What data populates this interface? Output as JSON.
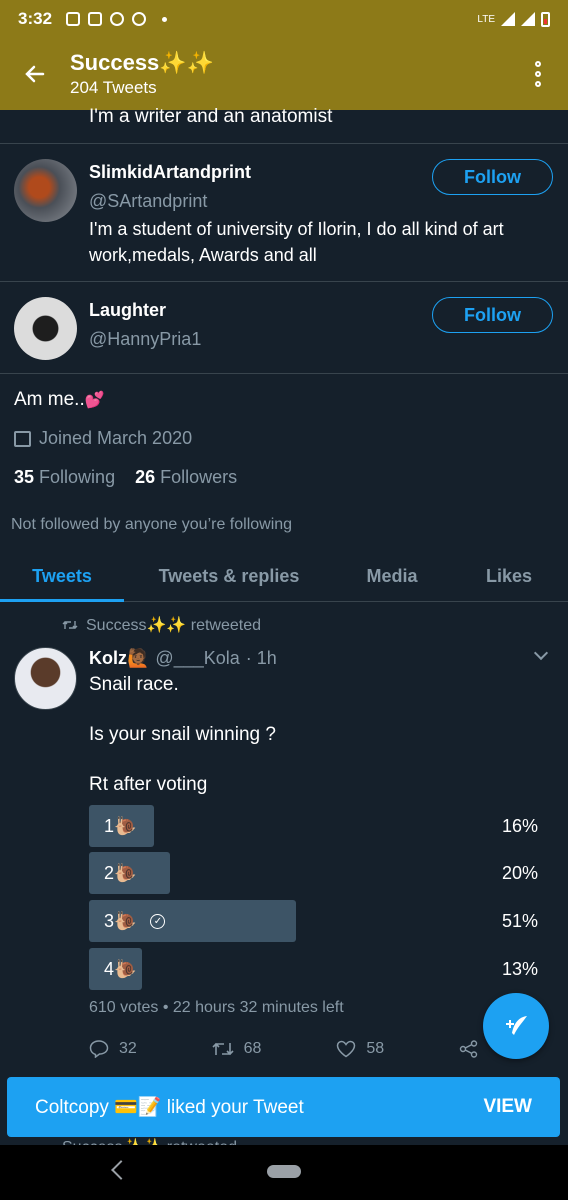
{
  "status_bar": {
    "time": "3:32",
    "network": "LTE",
    "icons": [
      "image-icon",
      "news-icon",
      "facebook-icon",
      "uc-browser-icon",
      "signal-icon",
      "battery-icon"
    ]
  },
  "header": {
    "title": "Success✨✨",
    "subtitle": "204 Tweets",
    "color": "#8d7a18"
  },
  "suggestions": {
    "partial_bio": "I'm a writer and an anatomist",
    "users": [
      {
        "name": "SlimkidArtandprint",
        "handle": "@SArtandprint",
        "bio": "I'm a student of university of Ilorin, I do all kind of art work,medals, Awards and all",
        "button": "Follow"
      },
      {
        "name": "Laughter",
        "handle": "@HannyPria1",
        "bio": "",
        "button": "Follow"
      }
    ]
  },
  "profile": {
    "bio": "Am me..",
    "bio_emoji": "💕",
    "joined": "Joined March 2020",
    "following_count": "35",
    "following_label": "Following",
    "followers_count": "26",
    "followers_label": "Followers",
    "not_followed": "Not followed by anyone you’re following"
  },
  "tabs": [
    {
      "label": "Tweets",
      "active": true
    },
    {
      "label": "Tweets & replies",
      "active": false
    },
    {
      "label": "Media",
      "active": false
    },
    {
      "label": "Likes",
      "active": false
    }
  ],
  "tweet": {
    "retweeted_by": "Success✨✨ retweeted",
    "author_name": "Kolz🙋🏾",
    "author_handle": "@___Kola",
    "time": "· 1h",
    "line1": "Snail race.",
    "line2": "Is your snail winning ?",
    "line3": "Rt after voting",
    "poll": {
      "options": [
        {
          "label": "1🐌",
          "percent": 16,
          "percent_text": "16%",
          "chosen": false
        },
        {
          "label": "2🐌",
          "percent": 20,
          "percent_text": "20%",
          "chosen": false
        },
        {
          "label": "3🐌",
          "percent": 51,
          "percent_text": "51%",
          "chosen": true
        },
        {
          "label": "4🐌",
          "percent": 13,
          "percent_text": "13%",
          "chosen": false
        }
      ],
      "meta": "610 votes • 22 hours 32 minutes left"
    },
    "replies": "32",
    "retweets": "68",
    "likes": "58"
  },
  "toast": {
    "message": "Coltcopy 💳📝 liked your Tweet",
    "action": "VIEW"
  },
  "next_tweet_peek": "Success✨✨ retweeted",
  "colors": {
    "background": "#15202b",
    "accent": "#1da1f2",
    "muted": "#8899a6",
    "poll_bar": "#3d5466"
  }
}
